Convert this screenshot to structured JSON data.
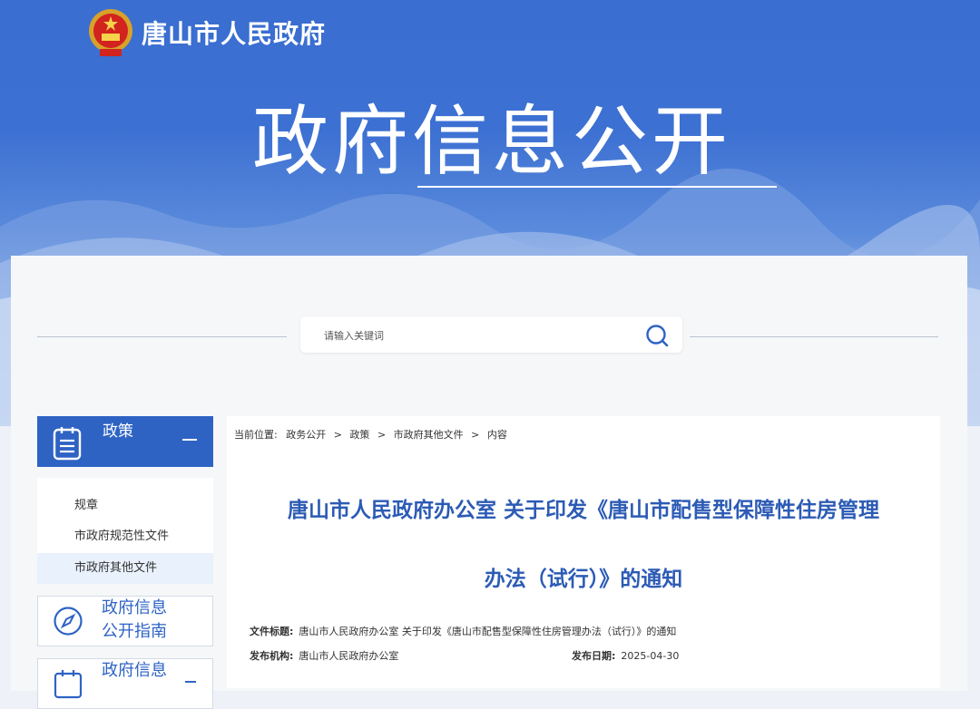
{
  "header": {
    "site_name": "唐山市人民政府",
    "page_title": "政府信息公开"
  },
  "search": {
    "placeholder": "请输入关键词",
    "icon": "search-icon"
  },
  "sidebar": {
    "section_title": "政策",
    "section_icon": "document-list-icon",
    "items": [
      {
        "label": "规章",
        "active": false
      },
      {
        "label": "市政府规范性文件",
        "active": false
      },
      {
        "label": "市政府其他文件",
        "active": true
      }
    ],
    "cards": [
      {
        "label_line1": "政府信息",
        "label_line2": "公开指南",
        "icon": "compass-icon"
      },
      {
        "label_line1": "政府信息",
        "label_line2": "",
        "icon": "calendar-icon"
      }
    ]
  },
  "breadcrumb": {
    "prefix": "当前位置:",
    "items": [
      "政务公开",
      "政策",
      "市政府其他文件",
      "内容"
    ],
    "separator": ">"
  },
  "article": {
    "title_line1": "唐山市人民政府办公室 关于印发《唐山市配售型保障性住房管理",
    "title_line2": "办法（试行）》的通知",
    "meta": {
      "title_label": "文件标题:",
      "title_value": "唐山市人民政府办公室 关于印发《唐山市配售型保障性住房管理办法（试行）》的通知",
      "issuer_label": "发布机构:",
      "issuer_value": "唐山市人民政府办公室",
      "date_label": "发布日期:",
      "date_value": "2025-04-30"
    }
  },
  "colors": {
    "primary": "#2e63c4",
    "title_blue": "#2c5bb5",
    "banner_top": "#3a6ed0"
  }
}
